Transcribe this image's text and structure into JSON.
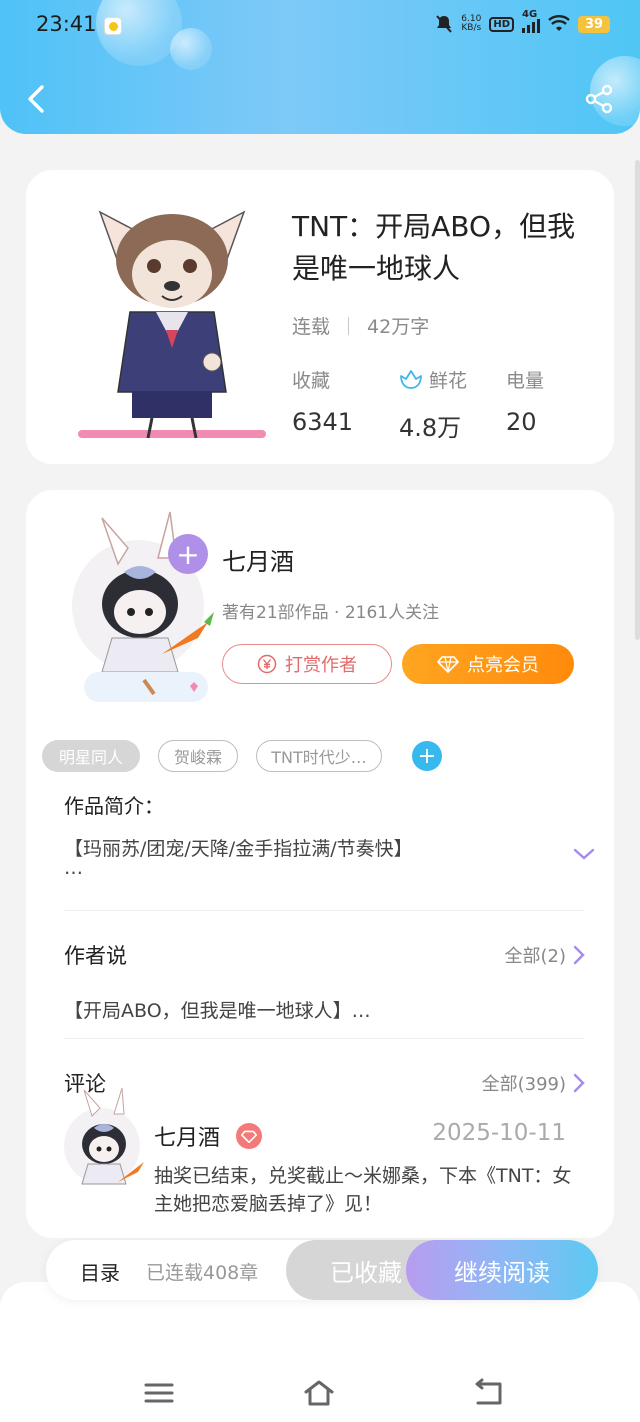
{
  "status_bar": {
    "time": "23:41",
    "net_speed_value": "6.10",
    "net_speed_unit": "KB/s",
    "hd": "HD",
    "network": "4G",
    "battery": "39"
  },
  "book": {
    "title": "TNT：开局ABO，但我是唯一地球人",
    "status": "连载",
    "word_count": "42万字",
    "stats": [
      {
        "label": "收藏",
        "value": "6341",
        "icon": "none"
      },
      {
        "label": "鲜花",
        "value": "4.8万",
        "icon": "flower-icon"
      },
      {
        "label": "电量",
        "value": "20",
        "icon": "none"
      }
    ]
  },
  "author": {
    "name": "七月酒",
    "meta": "著有21部作品 · 2161人关注",
    "tip_label": "打赏作者",
    "vip_label": "点亮会员",
    "follow_symbol": "+"
  },
  "tags": [
    "明星同人",
    "贺峻霖",
    "TNT时代少…"
  ],
  "intro": {
    "title": "作品简介：",
    "text": "【玛丽苏/团宠/天降/金手指拉满/节奏快】",
    "ellipsis": "…"
  },
  "author_says": {
    "title": "作者说",
    "all_label": "全部(2)",
    "text": "【开局ABO，但我是唯一地球人】…"
  },
  "comments": {
    "title": "评论",
    "all_label": "全部(399)",
    "items": [
      {
        "name": "七月酒",
        "date": "2025-10-11",
        "text": "抽奖已结束，兑奖截止～米娜桑，下本《TNT：女主她把恋爱脑丢掉了》见！"
      }
    ]
  },
  "bottom_bar": {
    "toc_label": "目录",
    "chapter_count": "已连载408章",
    "fav_label": "已收藏",
    "read_label": "继续阅读"
  },
  "colors": {
    "header_gradient": [
      "#4fc2f7",
      "#7ec9f8"
    ],
    "vip_orange": "#ff8a0c",
    "tip_red": "#e36a6a",
    "accent_purple": "#a58be8",
    "accent_blue": "#38b9ee"
  }
}
